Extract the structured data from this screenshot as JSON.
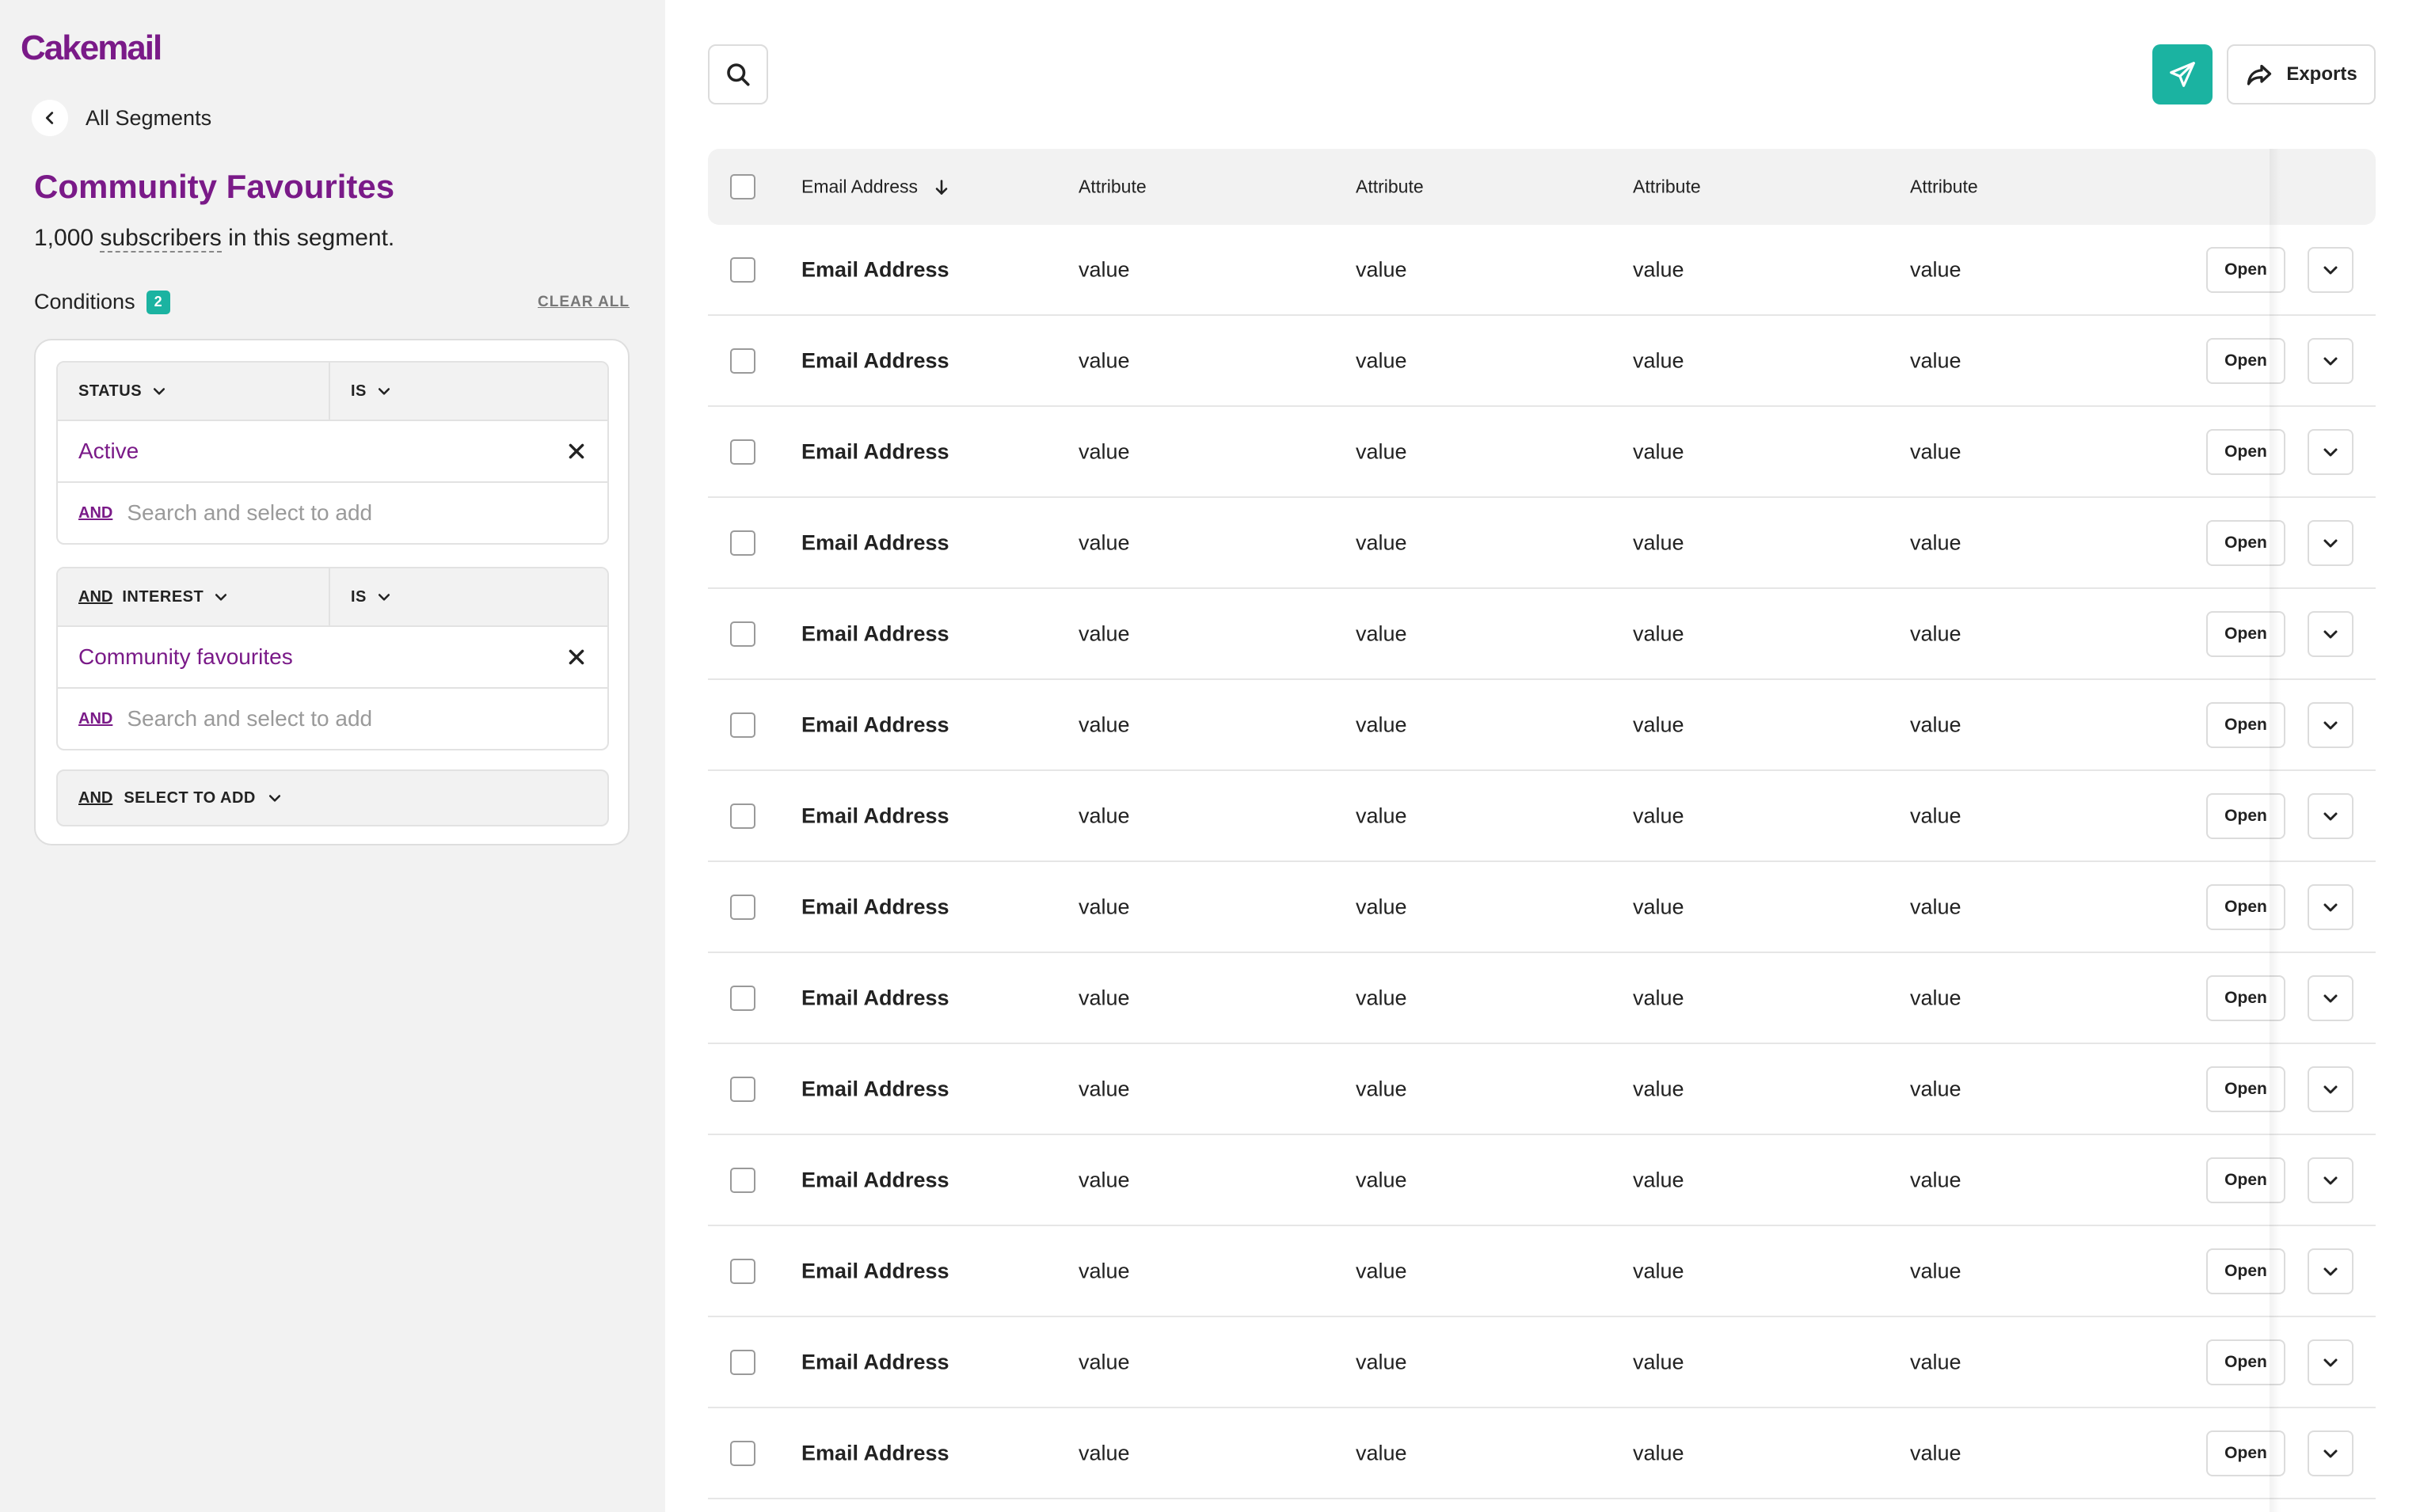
{
  "app": {
    "logo_text": "Cakemail"
  },
  "sidebar": {
    "back_label": "All Segments",
    "segment_title": "Community Favourites",
    "count": "1,000",
    "count_unit": "subscribers",
    "count_suffix": "in this segment.",
    "conditions_label": "Conditions",
    "conditions_count": "2",
    "clear_all": "CLEAR ALL",
    "groups": [
      {
        "prefix": "",
        "field": "STATUS",
        "operator": "IS",
        "chip": "Active",
        "and_label": "AND",
        "placeholder": "Search and select to add"
      },
      {
        "prefix": "AND",
        "field": "INTEREST",
        "operator": "IS",
        "chip": "Community favourites",
        "and_label": "AND",
        "placeholder": "Search and select to add"
      }
    ],
    "add_group": {
      "and_label": "AND",
      "label": "SELECT TO ADD"
    }
  },
  "toolbar": {
    "search_icon": "search-icon",
    "send_icon": "paper-plane-icon",
    "exports_label": "Exports"
  },
  "table": {
    "headers": [
      "Email Address",
      "Attribute",
      "Attribute",
      "Attribute",
      "Attribute"
    ],
    "rows": [
      [
        "Email Address",
        "value",
        "value",
        "value",
        "value"
      ],
      [
        "Email Address",
        "value",
        "value",
        "value",
        "value"
      ],
      [
        "Email Address",
        "value",
        "value",
        "value",
        "value"
      ],
      [
        "Email Address",
        "value",
        "value",
        "value",
        "value"
      ],
      [
        "Email Address",
        "value",
        "value",
        "value",
        "value"
      ],
      [
        "Email Address",
        "value",
        "value",
        "value",
        "value"
      ],
      [
        "Email Address",
        "value",
        "value",
        "value",
        "value"
      ],
      [
        "Email Address",
        "value",
        "value",
        "value",
        "value"
      ],
      [
        "Email Address",
        "value",
        "value",
        "value",
        "value"
      ],
      [
        "Email Address",
        "value",
        "value",
        "value",
        "value"
      ],
      [
        "Email Address",
        "value",
        "value",
        "value",
        "value"
      ],
      [
        "Email Address",
        "value",
        "value",
        "value",
        "value"
      ],
      [
        "Email Address",
        "value",
        "value",
        "value",
        "value"
      ],
      [
        "Email Address",
        "value",
        "value",
        "value",
        "value"
      ]
    ],
    "open_label": "Open"
  },
  "colors": {
    "brand": "#7a1a88",
    "accent": "#1bb3a1",
    "sidebar_bg": "#f2f2f2"
  }
}
